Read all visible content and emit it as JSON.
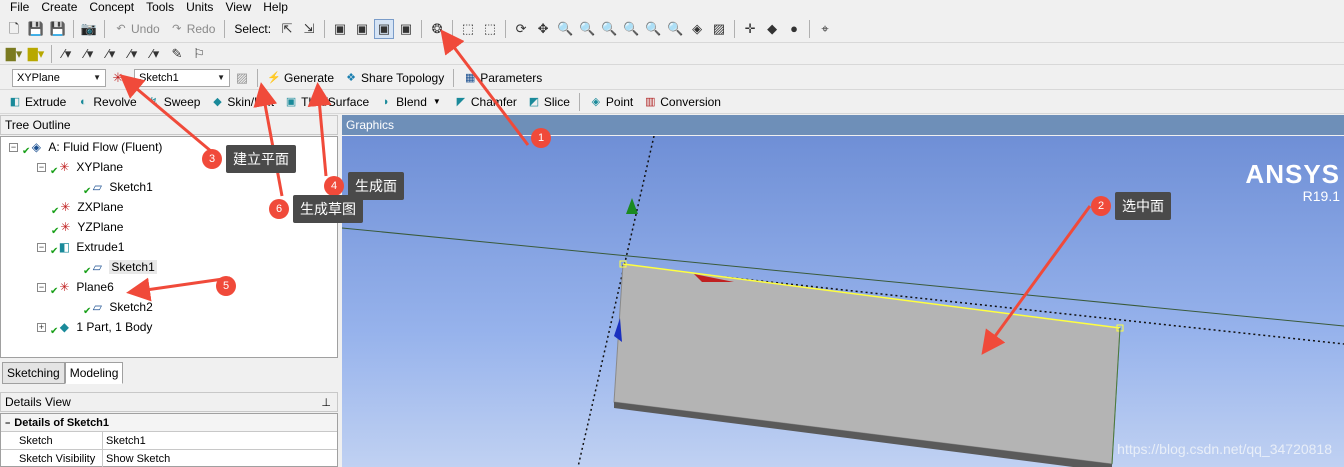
{
  "menu": [
    "File",
    "Create",
    "Concept",
    "Tools",
    "Units",
    "View",
    "Help"
  ],
  "toolbar1": {
    "undo_label": "Undo",
    "redo_label": "Redo",
    "select_label": "Select:"
  },
  "toolbar3": {
    "plane_value": "XYPlane",
    "sketch_value": "Sketch1",
    "generate_label": "Generate",
    "share_topology_label": "Share Topology",
    "parameters_label": "Parameters"
  },
  "toolbar4": {
    "items": [
      "Extrude",
      "Revolve",
      "Sweep",
      "Skin/Loft",
      "Thin/Surface",
      "Blend",
      "Chamfer",
      "Slice",
      "Point",
      "Conversion"
    ]
  },
  "tree": {
    "title": "Tree Outline",
    "nodes": [
      "A: Fluid Flow (Fluent)",
      "XYPlane",
      "Sketch1",
      "ZXPlane",
      "YZPlane",
      "Extrude1",
      "Sketch1",
      "Plane6",
      "Sketch2",
      "1 Part, 1 Body"
    ]
  },
  "tabs": [
    "Sketching",
    "Modeling"
  ],
  "details": {
    "title": "Details View",
    "header": "Details of Sketch1",
    "rows": [
      {
        "key": "Sketch",
        "value": "Sketch1"
      },
      {
        "key": "Sketch Visibility",
        "value": "Show Sketch"
      }
    ]
  },
  "graphics": {
    "title": "Graphics",
    "brand_name": "ANSYS",
    "brand_version": "R19.1",
    "watermark": "https://blog.csdn.net/qq_34720818"
  },
  "callouts": [
    {
      "num": "1",
      "text": ""
    },
    {
      "num": "2",
      "text": "选中面"
    },
    {
      "num": "3",
      "text": "建立平面"
    },
    {
      "num": "4",
      "text": "生成面"
    },
    {
      "num": "5",
      "text": ""
    },
    {
      "num": "6",
      "text": "生成草图"
    }
  ],
  "colors": {
    "callout_red": "#f04a3a",
    "graphics_title_bg": "#6e8fb8",
    "face_gray": "#b4b4b4"
  }
}
